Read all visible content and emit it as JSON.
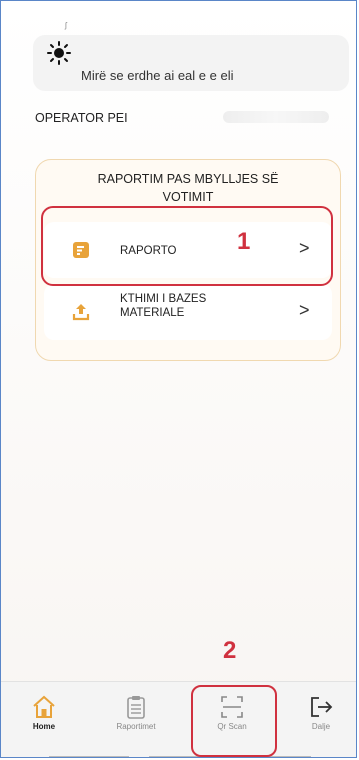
{
  "header": {
    "status_mark": "ʃ",
    "welcome_text": "Mirë se erdhe  ai eal e  e eli"
  },
  "operator": {
    "label": "OPERATOR PEI"
  },
  "report_card": {
    "title": "RAPORTIM PAS MBYLLJES SË\nVOTIMIT",
    "items": [
      {
        "label": "RAPORTO",
        "icon": "document-icon",
        "chevron": ">"
      },
      {
        "label": "KTHIMI I BAZES\nMATERIALE",
        "icon": "upload-icon",
        "chevron": ">"
      }
    ]
  },
  "annotations": {
    "one": "1",
    "two": "2"
  },
  "nav": {
    "items": [
      {
        "label": "Home",
        "icon": "home-icon"
      },
      {
        "label": "Raportimet",
        "icon": "clipboard-icon"
      },
      {
        "label": "Qr Scan",
        "icon": "qr-scan-icon"
      },
      {
        "label": "Dalje",
        "icon": "logout-icon"
      }
    ]
  },
  "colors": {
    "accent": "#e8a33a",
    "annotation": "#d0313f",
    "frame": "#5a86c8"
  }
}
